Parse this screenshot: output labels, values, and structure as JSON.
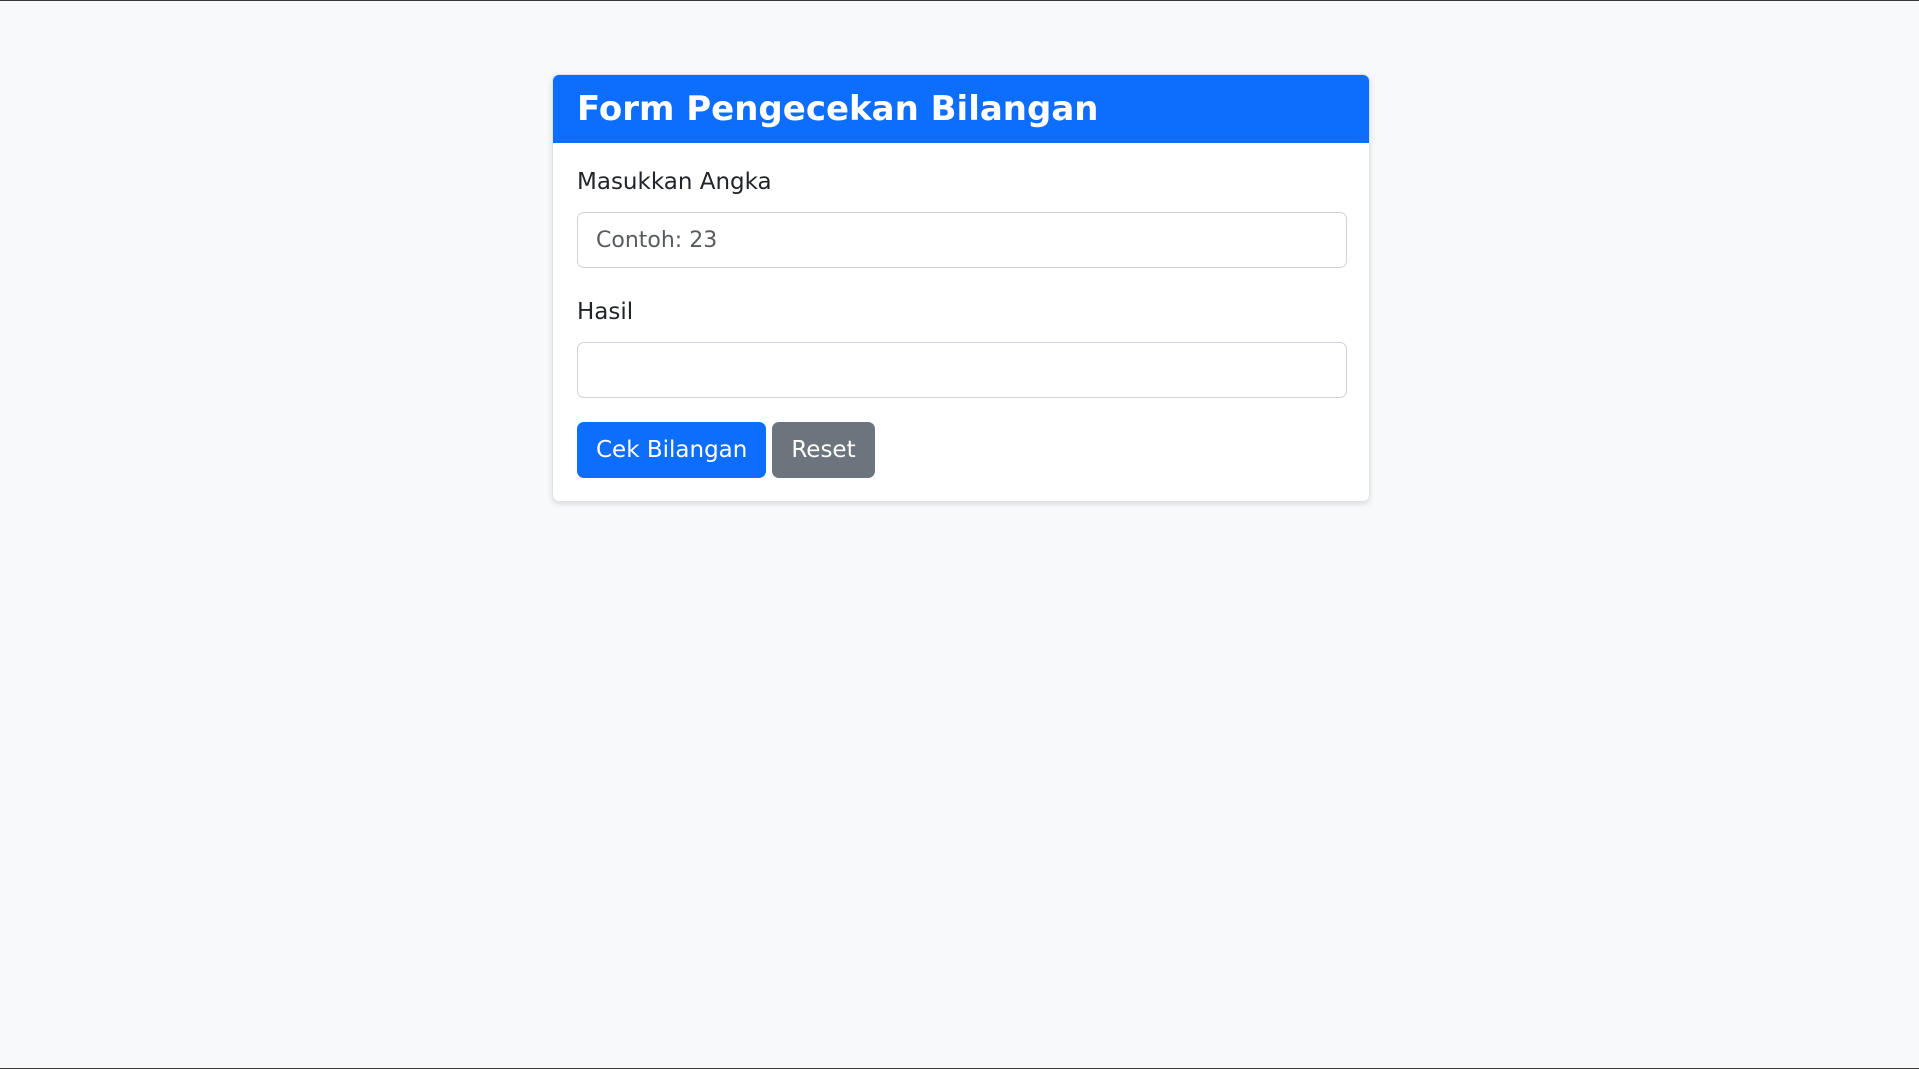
{
  "form": {
    "title": "Form Pengecekan Bilangan",
    "number_label": "Masukkan Angka",
    "number_value": "",
    "number_placeholder": "Contoh: 23",
    "result_label": "Hasil",
    "result_value": "",
    "result_placeholder": "",
    "check_button_label": "Cek Bilangan",
    "reset_button_label": "Reset"
  },
  "colors": {
    "page_background": "#f8f9fa",
    "primary": "#0d6efd",
    "secondary": "#6c757d",
    "text": "#212529"
  }
}
